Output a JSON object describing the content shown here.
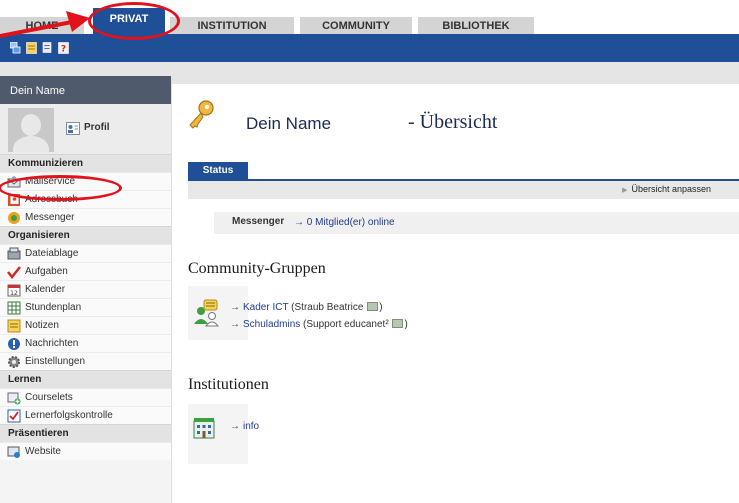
{
  "nav": {
    "tabs": [
      {
        "label": "HOME"
      },
      {
        "label": "PRIVAT"
      },
      {
        "label": "INSTITUTION"
      },
      {
        "label": "COMMUNITY"
      },
      {
        "label": "BIBLIOTHEK"
      }
    ],
    "active": "PRIVAT"
  },
  "toolbar": {
    "icons": [
      "windows-icon",
      "notes-icon",
      "bookmark-icon",
      "help-icon"
    ]
  },
  "sidebar": {
    "header": "Dein Name",
    "profile_link": "Profil",
    "sections": [
      {
        "title": "Kommunizieren",
        "items": [
          "Mailservice",
          "Adressbuch",
          "Messenger"
        ]
      },
      {
        "title": "Organisieren",
        "items": [
          "Dateiablage",
          "Aufgaben",
          "Kalender",
          "Stundenplan",
          "Notizen",
          "Nachrichten",
          "Einstellungen"
        ]
      },
      {
        "title": "Lernen",
        "items": [
          "Courselets",
          "Lernerfolgskontrolle"
        ]
      },
      {
        "title": "Präsentieren",
        "items": [
          "Website"
        ]
      }
    ]
  },
  "main": {
    "user_name": "Dein Name",
    "page_title": "- Übersicht",
    "status_tab": "Status",
    "customize_link": "Übersicht anpassen",
    "messenger_label": "Messenger",
    "messenger_online": "0 Mitglied(er) online",
    "community_title": "Community-Gruppen",
    "groups": [
      {
        "name": "Kader ICT",
        "detail": "(Straub Beatrice",
        "close": ")"
      },
      {
        "name": "Schuladmins",
        "detail": "(Support educanet²",
        "close": ")"
      }
    ],
    "institutions_title": "Institutionen",
    "institution_link": "info"
  },
  "colors": {
    "primary_blue": "#1f4f96",
    "sidebar_header": "#4f5b6d",
    "annotation_red": "#e1121c",
    "link_blue": "#1f3c8a"
  }
}
